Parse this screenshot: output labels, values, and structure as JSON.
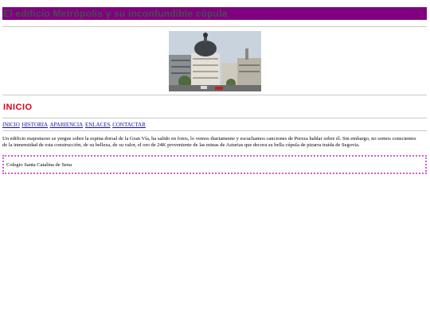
{
  "header": {
    "title": "El edificio Metrópolis y su inconfundible cúpula",
    "banner_color": "#800080"
  },
  "hero_image": {
    "description_icon": "building-photo"
  },
  "section": {
    "title": "INICIO",
    "title_color": "#e0001a"
  },
  "nav": {
    "links": [
      {
        "label": "INICIO"
      },
      {
        "label": "HISTORIA"
      },
      {
        "label": "APARIENCIA"
      },
      {
        "label": "ENLACES"
      },
      {
        "label": "CONTACTAR"
      }
    ]
  },
  "main": {
    "paragraph": "Un edificio majestuoso se yergue sobre la espina dorsal de la Gran Vía, ha salido en fotos, lo vemos diariamente y escuchamos canciones de Pereza hablar sobre él. Sin embargo, no somos conscientes de la inmensidad de esta construcción, de su belleza, de su valor, el oro de 24K proveniente de las minas de Asturias que decora su bella cúpula de pizarra traída de Segovia."
  },
  "footer": {
    "text": "Colegio Santa Catalina de Sena",
    "border_color": "#d65ad6"
  }
}
